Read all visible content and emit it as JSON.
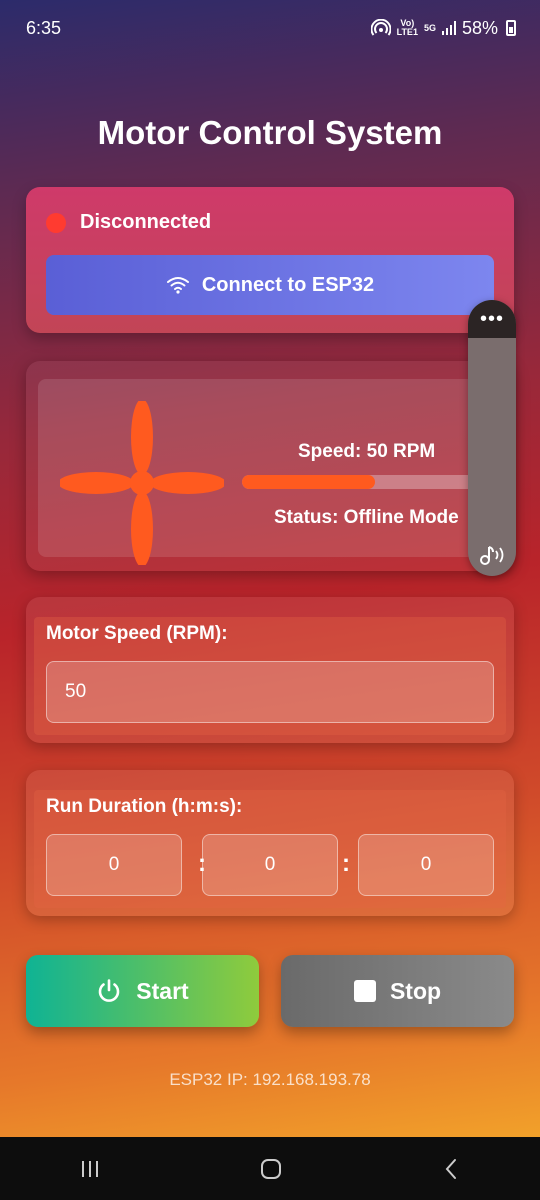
{
  "status_bar": {
    "time": "6:35",
    "volte": "Vo)",
    "lte": "LTE1",
    "network": "5G",
    "battery": "58%"
  },
  "app": {
    "title": "Motor Control System"
  },
  "connection": {
    "status": "Disconnected",
    "status_color": "#ff3b30",
    "button_label": "Connect to ESP32"
  },
  "motor": {
    "speed_text": "Speed: 50 RPM",
    "speed_fraction": 0.53,
    "status_text": "Status: Offline Mode",
    "fan_color": "#ff5a1f"
  },
  "speed_input": {
    "label": "Motor Speed (RPM):",
    "value": "50"
  },
  "duration": {
    "label": "Run Duration (h:m:s):",
    "hours": "0",
    "minutes": "0",
    "seconds": "0",
    "separator": ":"
  },
  "actions": {
    "start_label": "Start",
    "stop_label": "Stop"
  },
  "footer": {
    "ip": "ESP32 IP: 192.168.193.78"
  },
  "floating_panel": {
    "menu": "•••"
  }
}
